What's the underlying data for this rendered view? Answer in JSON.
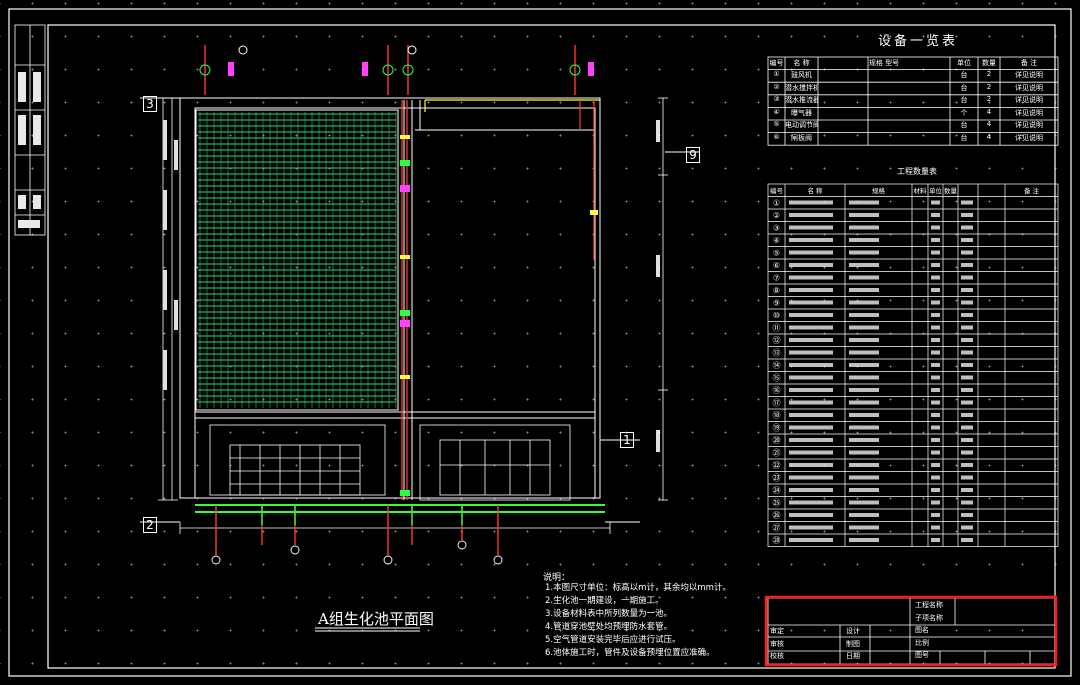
{
  "title": "A组生化池平面图",
  "equipment_table": {
    "title": "设备一览表",
    "headers": [
      "编号",
      "名 称",
      "规格 型号",
      "单位",
      "数量",
      "备 注"
    ],
    "rows": [
      [
        "①",
        "鼓风机",
        "",
        "台",
        "2",
        "详见说明"
      ],
      [
        "②",
        "潜水搅拌机",
        "",
        "台",
        "2",
        "详见说明"
      ],
      [
        "③",
        "潜水推流器",
        "",
        "台",
        "2",
        "详见说明"
      ],
      [
        "④",
        "曝气器",
        "",
        "个",
        "4",
        "详见说明"
      ],
      [
        "⑤",
        "电动调节阀",
        "",
        "台",
        "4",
        "详见说明"
      ],
      [
        "⑥",
        "闸板阀",
        "",
        "台",
        "4",
        "详见说明"
      ]
    ]
  },
  "material_table": {
    "title": "工程数量表",
    "headers": [
      "编号",
      "名 称",
      "规格",
      "材料",
      "单位",
      "数量",
      "",
      "备 注"
    ],
    "rows": [
      [
        "①",
        "",
        "",
        "",
        "",
        "",
        "",
        ""
      ],
      [
        "②",
        "",
        "",
        "",
        "",
        "",
        "",
        ""
      ],
      [
        "③",
        "",
        "",
        "",
        "",
        "",
        "",
        ""
      ],
      [
        "④",
        "",
        "",
        "",
        "",
        "",
        "",
        ""
      ],
      [
        "⑤",
        "",
        "",
        "",
        "",
        "",
        "",
        ""
      ],
      [
        "⑥",
        "",
        "",
        "",
        "",
        "",
        "",
        ""
      ],
      [
        "⑦",
        "",
        "",
        "",
        "",
        "",
        "",
        ""
      ],
      [
        "⑧",
        "",
        "",
        "",
        "",
        "",
        "",
        ""
      ],
      [
        "⑨",
        "",
        "",
        "",
        "",
        "",
        "",
        ""
      ],
      [
        "⑩",
        "",
        "",
        "",
        "",
        "",
        "",
        ""
      ],
      [
        "⑪",
        "",
        "",
        "",
        "",
        "",
        "",
        ""
      ],
      [
        "⑫",
        "",
        "",
        "",
        "",
        "",
        "",
        ""
      ],
      [
        "⑬",
        "",
        "",
        "",
        "",
        "",
        "",
        ""
      ],
      [
        "⑭",
        "",
        "",
        "",
        "",
        "",
        "",
        ""
      ],
      [
        "⑮",
        "",
        "",
        "",
        "",
        "",
        "",
        ""
      ],
      [
        "⑯",
        "",
        "",
        "",
        "",
        "",
        "",
        ""
      ],
      [
        "⑰",
        "",
        "",
        "",
        "",
        "",
        "",
        ""
      ],
      [
        "⑱",
        "",
        "",
        "",
        "",
        "",
        "",
        ""
      ],
      [
        "⑲",
        "",
        "",
        "",
        "",
        "",
        "",
        ""
      ],
      [
        "⑳",
        "",
        "",
        "",
        "",
        "",
        "",
        ""
      ],
      [
        "㉑",
        "",
        "",
        "",
        "",
        "",
        "",
        ""
      ],
      [
        "㉒",
        "",
        "",
        "",
        "",
        "",
        "",
        ""
      ],
      [
        "㉓",
        "",
        "",
        "",
        "",
        "",
        "",
        ""
      ],
      [
        "㉔",
        "",
        "",
        "",
        "",
        "",
        "",
        ""
      ],
      [
        "㉕",
        "",
        "",
        "",
        "",
        "",
        "",
        ""
      ],
      [
        "㉖",
        "",
        "",
        "",
        "",
        "",
        "",
        ""
      ],
      [
        "㉗",
        "",
        "",
        "",
        "",
        "",
        "",
        ""
      ],
      [
        "㉘",
        "",
        "",
        "",
        "",
        "",
        "",
        ""
      ]
    ]
  },
  "notes": {
    "title": "说明：",
    "lines": [
      "1.本图尺寸单位：标高以m计，其余均以mm计。",
      "2.生化池一期建设，一期施工。",
      "3.设备材料表中所列数量为一池。",
      "4.管道穿池壁处均预埋防水套管。",
      "5.空气管道安装完毕后应进行试压。",
      "6.池体施工时，管件及设备预埋位置应准确。"
    ]
  },
  "axis_labels": {
    "a3": "3",
    "a2": "2",
    "a1": "1",
    "b9": "9"
  },
  "title_block": {
    "rows": [
      [
        "审定",
        "",
        "设计"
      ],
      [
        "审核",
        "",
        "制图"
      ],
      [
        "校核",
        "",
        "日期"
      ]
    ],
    "fields": [
      "工程名称",
      "子项名称",
      "图名",
      "比例",
      "图号"
    ]
  },
  "colors": {
    "background": "#000000",
    "frame": "#ffffff",
    "aeration_grid": "#2bd97a",
    "pipe_red": "#ff3b2b",
    "pipe_green": "#30ff40",
    "valve_magenta": "#ff40ff",
    "pipe_yellow": "#ffff40",
    "highlight_box": "#ff1a1a"
  }
}
